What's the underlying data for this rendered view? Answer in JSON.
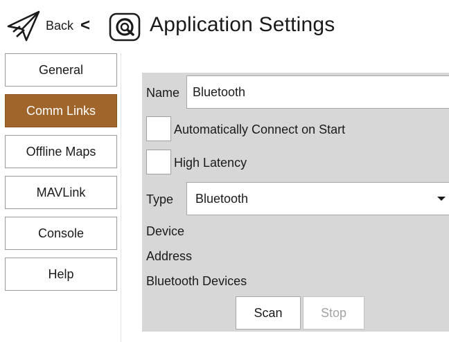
{
  "header": {
    "back_label": "Back",
    "back_chevron": "<",
    "title": "Application Settings",
    "back_icon": "paper-plane-arrow-icon",
    "app_icon": "qgc-logo-icon"
  },
  "sidebar": {
    "active_color": "#a0652a",
    "items": [
      {
        "label": "General",
        "active": false
      },
      {
        "label": "Comm Links",
        "active": true
      },
      {
        "label": "Offline Maps",
        "active": false
      },
      {
        "label": "MAVLink",
        "active": false
      },
      {
        "label": "Console",
        "active": false
      },
      {
        "label": "Help",
        "active": false
      }
    ]
  },
  "form": {
    "name_label": "Name",
    "name_value": "Bluetooth",
    "auto_connect_label": "Automatically Connect on Start",
    "auto_connect_checked": false,
    "high_latency_label": "High Latency",
    "high_latency_checked": false,
    "type_label": "Type",
    "type_value": "Bluetooth",
    "device_label": "Device",
    "address_label": "Address",
    "devices_label": "Bluetooth Devices",
    "scan_label": "Scan",
    "stop_label": "Stop",
    "stop_enabled": false
  }
}
